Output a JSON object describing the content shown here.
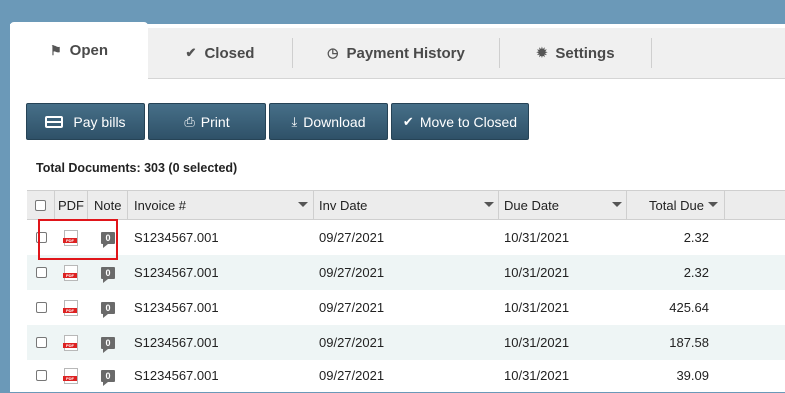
{
  "tabs": [
    {
      "label": "Open",
      "icon": "flag-icon",
      "active": true
    },
    {
      "label": "Closed",
      "icon": "check-icon",
      "active": false
    },
    {
      "label": "Payment History",
      "icon": "clock-icon",
      "active": false
    },
    {
      "label": "Settings",
      "icon": "gear-icon",
      "active": false
    }
  ],
  "toolbar": {
    "pay_bills": "Pay bills",
    "print": "Print",
    "download": "Download",
    "move_to_closed": "Move to Closed"
  },
  "summary": {
    "total_documents": "Total Documents: 303 (0 selected)"
  },
  "table": {
    "columns": [
      "PDF",
      "Note",
      "Invoice #",
      "Inv Date",
      "Due Date",
      "Total Due"
    ],
    "rows": [
      {
        "note_count": "0",
        "invoice": "S1234567.001",
        "inv_date": "09/27/2021",
        "due_date": "10/31/2021",
        "total_due": "2.32"
      },
      {
        "note_count": "0",
        "invoice": "S1234567.001",
        "inv_date": "09/27/2021",
        "due_date": "10/31/2021",
        "total_due": "2.32"
      },
      {
        "note_count": "0",
        "invoice": "S1234567.001",
        "inv_date": "09/27/2021",
        "due_date": "10/31/2021",
        "total_due": "425.64"
      },
      {
        "note_count": "0",
        "invoice": "S1234567.001",
        "inv_date": "09/27/2021",
        "due_date": "10/31/2021",
        "total_due": "187.58"
      },
      {
        "note_count": "0",
        "invoice": "S1234567.001",
        "inv_date": "09/27/2021",
        "due_date": "10/31/2021",
        "total_due": "39.09"
      }
    ]
  },
  "colors": {
    "background": "#6b99b8",
    "button": "#3a5f77",
    "highlight": "#e0151a",
    "row_alt": "#eef5f5"
  }
}
